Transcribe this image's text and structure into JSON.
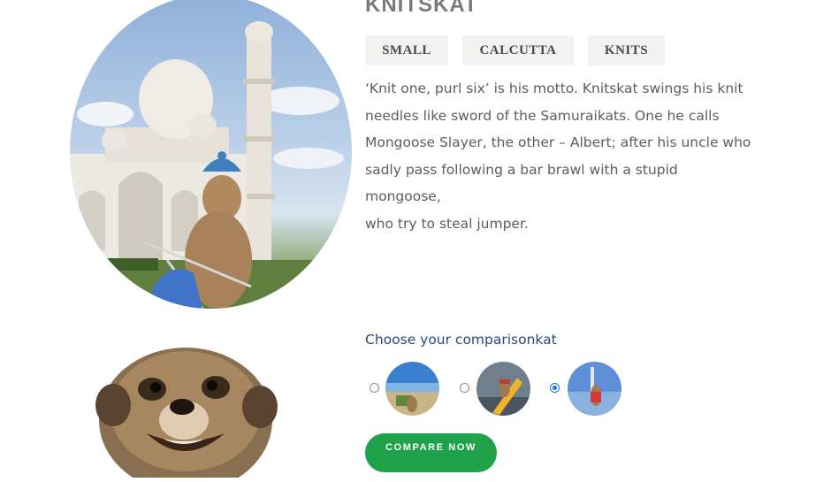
{
  "product": {
    "title": "KNITSKAT",
    "image_alt": "Meerkat knitting in front of the Taj Mahal",
    "tags": [
      "SMALL",
      "CALCUTTA",
      "KNITS"
    ],
    "description_lines": [
      "‘Knit one, purl six’ is his motto. Knitskat swings his knit",
      "needles like sword of the Samuraikats. One he calls",
      "Mongoose Slayer, the other – Albert; after his uncle who",
      "sadly pass following a bar brawl with a stupid mongoose,",
      "who try to steal jumper."
    ]
  },
  "comparison": {
    "heading": "Choose your comparisonkat",
    "options": [
      {
        "name": "beach-kat",
        "selected": false
      },
      {
        "name": "surfer-kat",
        "selected": false
      },
      {
        "name": "seaside-kat",
        "selected": true
      }
    ],
    "button_label": "COMPARE NOW"
  },
  "colors": {
    "button": "#1fa24a",
    "heading": "#2a4a7a",
    "radio_selected": "#1a73e8"
  }
}
